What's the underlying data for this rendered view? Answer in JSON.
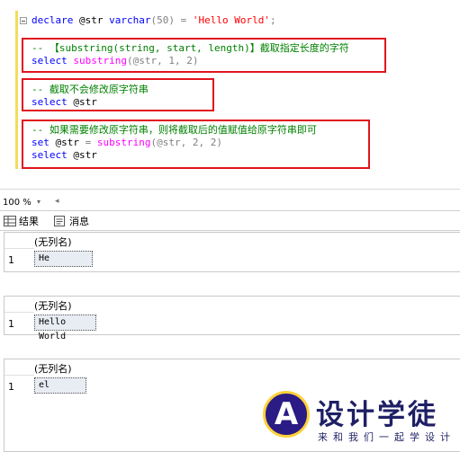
{
  "editor": {
    "lines": {
      "l1": {
        "kw1": "declare",
        "var1": " @str ",
        "kw2": "varchar",
        "p1": "(50) ",
        "op": "=",
        "str": " 'Hello World'",
        "end": ";"
      },
      "l2": {
        "comment": "-- 【substring(string, start, length)】截取指定长度的字符"
      },
      "l3": {
        "kw": "select",
        "sp": " ",
        "fn": "substring",
        "args": "(@str, 1, 2)"
      },
      "l4": {
        "comment": "-- 截取不会修改原字符串"
      },
      "l5": {
        "kw": "select",
        "rest": " @str"
      },
      "l6": {
        "comment": "-- 如果需要修改原字符串，则将截取后的值赋值给原字符串即可"
      },
      "l7": {
        "kw": "set",
        "var": " @str ",
        "op": "=",
        "sp": " ",
        "fn": "substring",
        "args": "(@str, 2, 2)"
      },
      "l8": {
        "kw": "select",
        "rest": " @str"
      }
    }
  },
  "zoom": {
    "level": "100 %",
    "dropdown_arrow": "▾",
    "scroll_left": "◂"
  },
  "tabs": {
    "results": "结果",
    "messages": "消息"
  },
  "results": [
    {
      "header": "(无列名)",
      "row_number": "1",
      "value": "He"
    },
    {
      "header": "(无列名)",
      "row_number": "1",
      "value": "Hello World"
    },
    {
      "header": "(无列名)",
      "row_number": "1",
      "value": "el"
    }
  ],
  "watermark": {
    "title": "设计学徒",
    "subtitle": "来和我们一起学设计",
    "letter": "A"
  },
  "colors": {
    "keyword": "#0000ff",
    "function": "#ff00ff",
    "string": "#ff0000",
    "comment": "#008000",
    "annotation_box": "#e0141e"
  }
}
